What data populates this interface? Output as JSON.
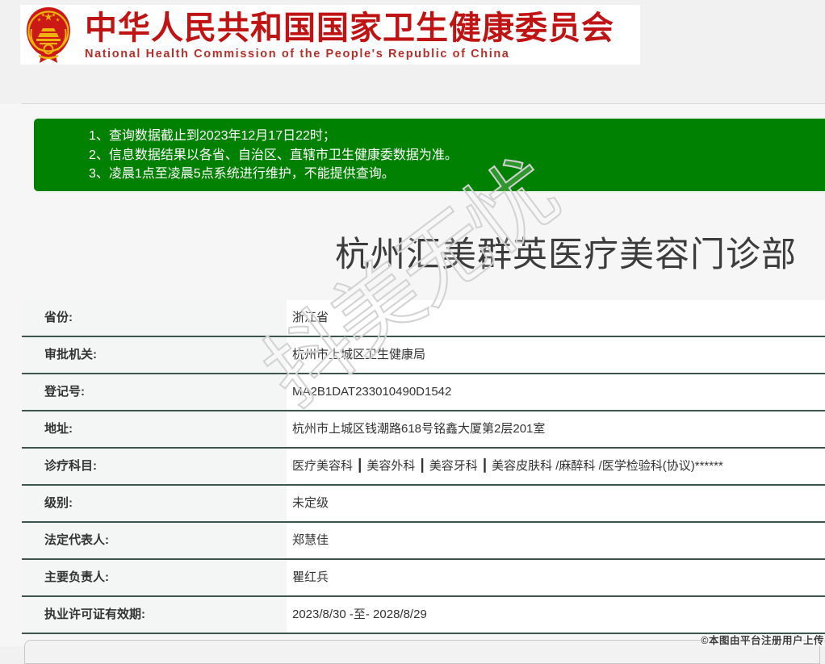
{
  "page": {
    "background_color": "#f1f1f1"
  },
  "header": {
    "emblem_icon": "prc-national-emblem",
    "title_cn": "中华人民共和国国家卫生健康委员会",
    "title_en": "National Health Commission of the People's Republic of China",
    "text_color": "#c01414"
  },
  "notice": {
    "background_color": "#018101",
    "lines": [
      "1、查询数据截止到2023年12月17日22时；",
      "2、信息数据结果以各省、自治区、直辖市卫生健康委数据为准。",
      "3、凌晨1点至凌晨5点系统进行维护，不能提供查询。"
    ]
  },
  "institution": {
    "name": "杭州汇美群英医疗美容门诊部",
    "table_border_color": "#3e544e",
    "label_cell_background": "#f4f6f5",
    "fields": [
      {
        "label": "省份:",
        "value": "浙江省"
      },
      {
        "label": "审批机关:",
        "value": "杭州市上城区卫生健康局"
      },
      {
        "label": "登记号:",
        "value": "MA2B1DAT233010490D1542"
      },
      {
        "label": "地址:",
        "value": "杭州市上城区钱潮路618号铭鑫大厦第2层201室"
      },
      {
        "label": "诊疗科目:",
        "value": "医疗美容科 ┃ 美容外科 ┃ 美容牙科 ┃ 美容皮肤科 /麻醉科 /医学检验科(协议)******"
      },
      {
        "label": "级别:",
        "value": "未定级"
      },
      {
        "label": "法定代表人:",
        "value": "郑慧佳"
      },
      {
        "label": "主要负责人:",
        "value": "瞿红兵"
      },
      {
        "label": "执业许可证有效期:",
        "value": "2023/8/30 -至- 2028/8/29"
      }
    ]
  },
  "watermark": {
    "text": "抖美无忧"
  },
  "footer": {
    "copyright": "©本图由平台注册用户上传"
  }
}
